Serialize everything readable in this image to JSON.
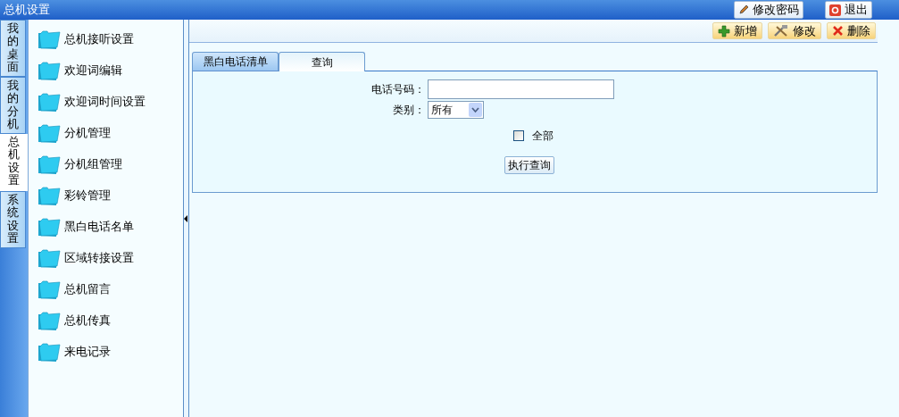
{
  "window": {
    "title": "总机设置"
  },
  "header_buttons": [
    {
      "kind": "password",
      "label": "修改密码"
    },
    {
      "kind": "exit",
      "label": "退出"
    }
  ],
  "side_tabs": [
    {
      "label": "我的桌面",
      "selected": false
    },
    {
      "label": "我的分机",
      "selected": false
    },
    {
      "label": "总机设置",
      "selected": true
    },
    {
      "label": "系统设置",
      "selected": false
    }
  ],
  "nav_items": [
    "总机接听设置",
    "欢迎词编辑",
    "欢迎词时间设置",
    "分机管理",
    "分机组管理",
    "彩铃管理",
    "黑白电话名单",
    "区域转接设置",
    "总机留言",
    "总机传真",
    "来电记录"
  ],
  "toolbar": [
    {
      "kind": "add",
      "label": "新增"
    },
    {
      "kind": "edit",
      "label": "修改"
    },
    {
      "kind": "delete",
      "label": "删除"
    }
  ],
  "tabs": [
    {
      "label": "黑白电话清单",
      "selected": false
    },
    {
      "label": "查询",
      "selected": true
    }
  ],
  "form": {
    "phone_label": "电话号码：",
    "category_label": "类别：",
    "category_value": "所有",
    "all_label": "全部",
    "all_checked": false,
    "submit": "执行查询"
  }
}
